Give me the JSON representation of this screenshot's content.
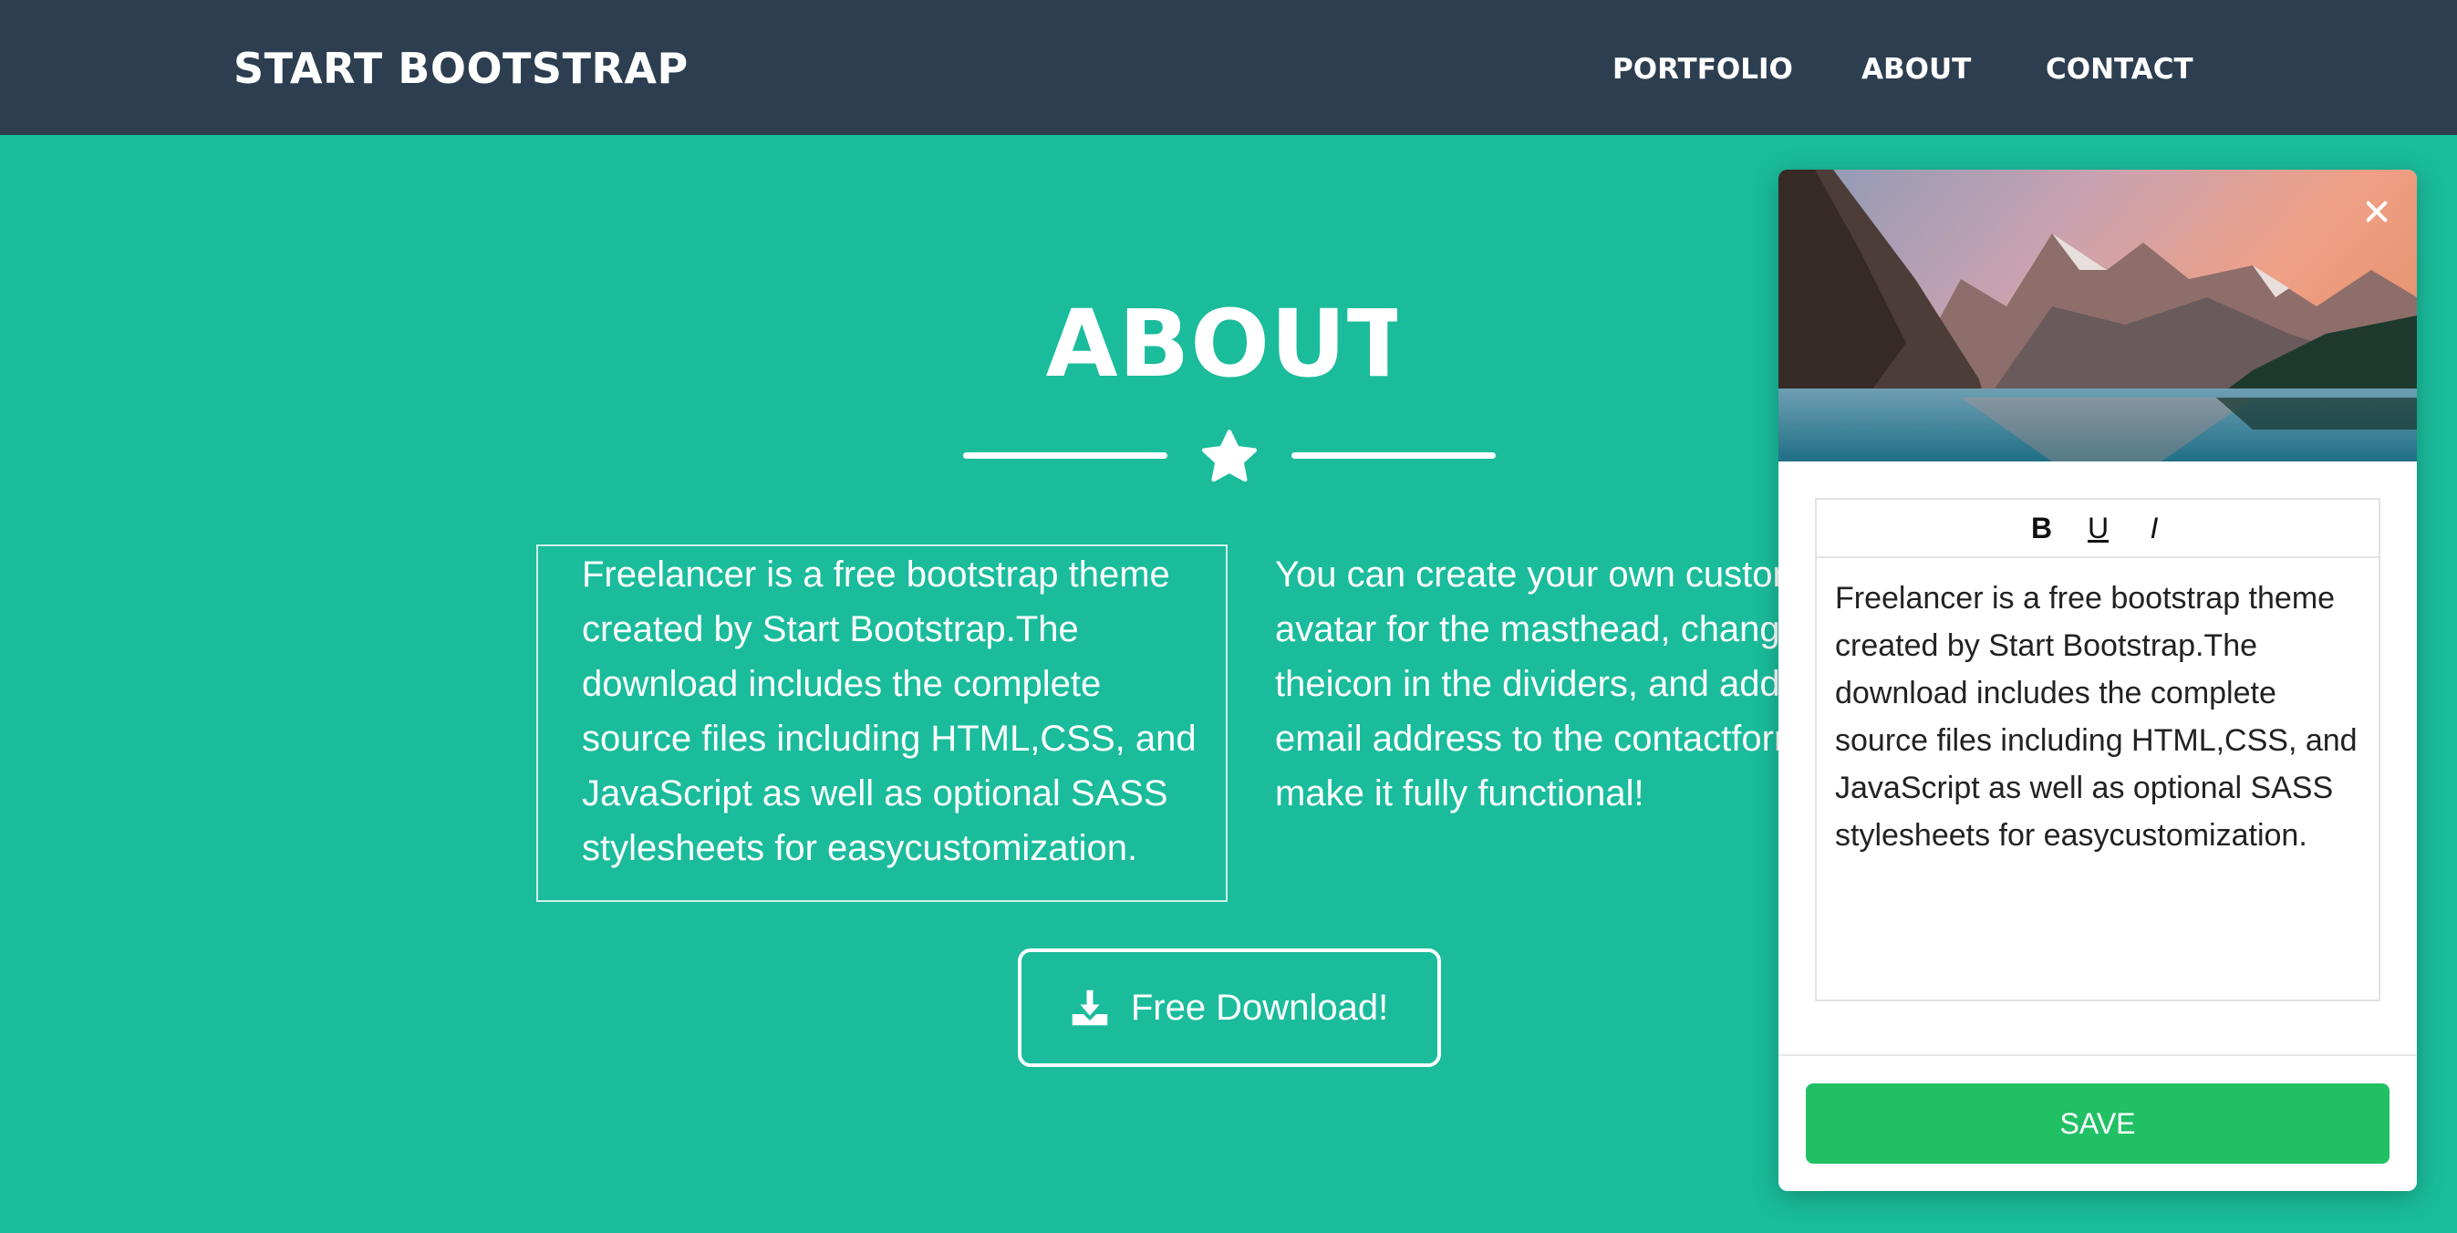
{
  "navbar": {
    "brand": "START BOOTSTRAP",
    "links": [
      {
        "label": "PORTFOLIO"
      },
      {
        "label": "ABOUT"
      },
      {
        "label": "CONTACT"
      }
    ]
  },
  "about": {
    "title": "ABOUT",
    "left_text": "Freelancer is a free bootstrap theme created by Start Bootstrap.The download includes the complete source files including HTML,CSS, and JavaScript as well as optional SASS stylesheets for easycustomization.",
    "right_text": "You can create your own custom\navatar for the masthead, change\ntheicon in the dividers, and add y\nemail address to the contactform\nmake it fully functional!",
    "download_label": "Free Download!"
  },
  "editor": {
    "toolbar": {
      "bold": "B",
      "underline": "U",
      "italic": "I"
    },
    "content": "Freelancer is a free bootstrap theme created by Start Bootstrap.The download includes the complete source files including HTML,CSS, and JavaScript as well as optional SASS stylesheets for easycustomization.",
    "save_label": "SAVE"
  },
  "colors": {
    "navbar": "#2c3e50",
    "section": "#1abc9c",
    "save": "#22c065"
  },
  "icons": [
    "star-icon",
    "download-icon",
    "close-icon"
  ]
}
